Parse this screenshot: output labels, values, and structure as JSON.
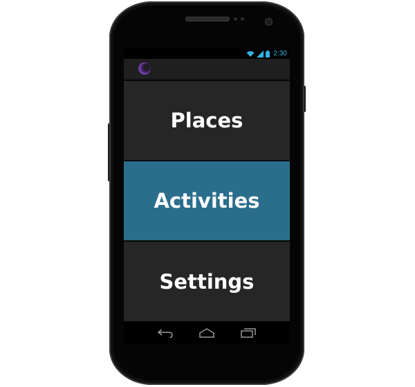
{
  "status_bar": {
    "time": "2:30",
    "icons": [
      "wifi-icon",
      "signal-icon",
      "battery-icon"
    ],
    "time_color": "#33b5e5"
  },
  "action_bar": {
    "app_icon": "app-logo-icon"
  },
  "menu": {
    "items": [
      {
        "label": "Places",
        "selected": false
      },
      {
        "label": "Activities",
        "selected": true
      },
      {
        "label": "Settings",
        "selected": false
      }
    ],
    "selected_color": "#2a6e8c",
    "item_color": "#262626"
  },
  "nav_bar": {
    "buttons": [
      "back-icon",
      "home-icon",
      "recent-apps-icon"
    ]
  }
}
